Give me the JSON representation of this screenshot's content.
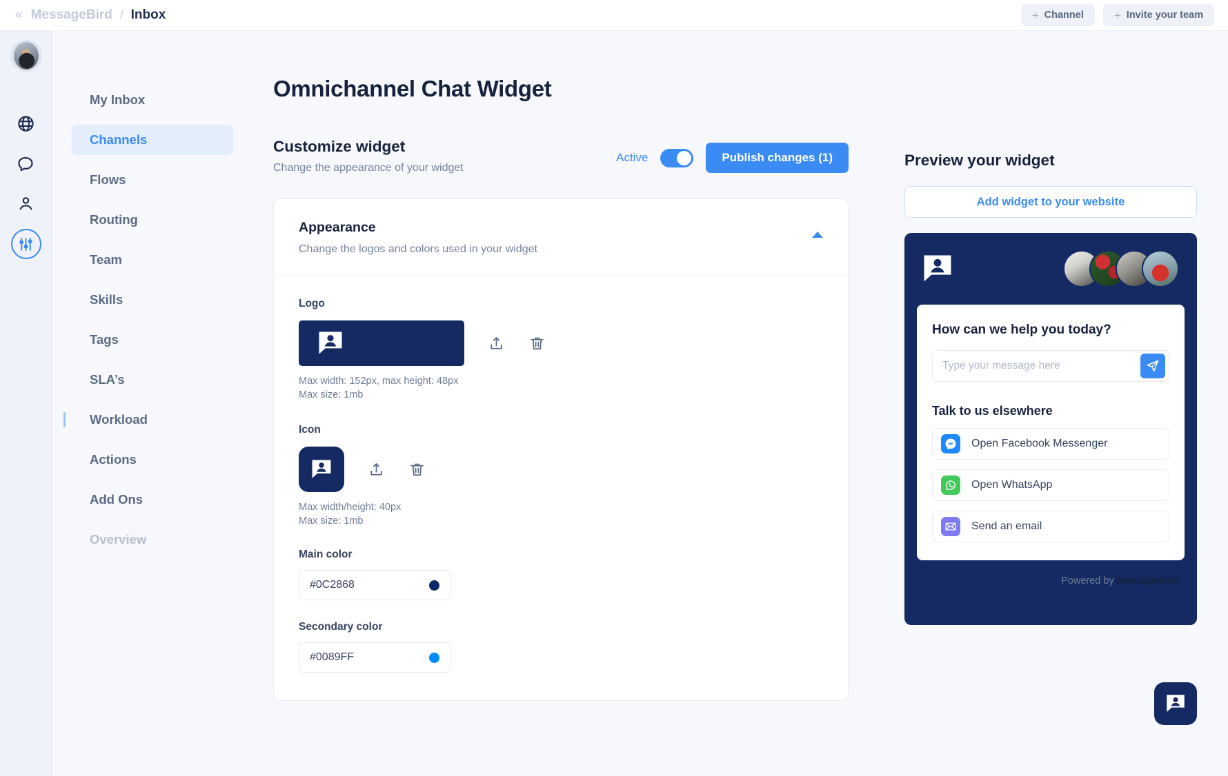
{
  "topbar": {
    "back_icon": "chevron-double-left-icon",
    "brand": "MessageBird",
    "separator": "/",
    "current": "Inbox",
    "channel_button": "Channel",
    "invite_button": "Invite your team",
    "plus": "+"
  },
  "rail": {
    "icons": [
      "avatar",
      "globe-icon",
      "chat-bubble-icon",
      "person-icon",
      "sliders-icon"
    ]
  },
  "sidebar": {
    "items": [
      {
        "label": "My Inbox",
        "state": "default"
      },
      {
        "label": "Channels",
        "state": "selected"
      },
      {
        "label": "Flows",
        "state": "default"
      },
      {
        "label": "Routing",
        "state": "default"
      },
      {
        "label": "Team",
        "state": "default"
      },
      {
        "label": "Skills",
        "state": "default"
      },
      {
        "label": "Tags",
        "state": "default"
      },
      {
        "label": "SLA’s",
        "state": "default"
      },
      {
        "label": "Workload",
        "state": "marked"
      },
      {
        "label": "Actions",
        "state": "default"
      },
      {
        "label": "Add Ons",
        "state": "default"
      },
      {
        "label": "Overview",
        "state": "muted"
      }
    ]
  },
  "main": {
    "page_title": "Omnichannel Chat Widget",
    "section": {
      "title": "Customize widget",
      "subtitle": "Change the appearance of your widget",
      "toggle_label": "Active",
      "toggle_state": "on",
      "publish_button": "Publish changes (1)"
    },
    "appearance_card": {
      "title": "Appearance",
      "subtitle": "Change the logos and colors used in your widget",
      "collapse_icon": "chevron-up-icon",
      "logo": {
        "label": "Logo",
        "hint_line1": "Max width: 152px, max height: 48px",
        "hint_line2": "Max size: 1mb",
        "upload_icon": "upload-icon",
        "delete_icon": "trash-icon"
      },
      "icon": {
        "label": "Icon",
        "hint_line1": "Max width/height: 40px",
        "hint_line2": "Max size: 1mb",
        "upload_icon": "upload-icon",
        "delete_icon": "trash-icon"
      },
      "main_color": {
        "label": "Main color",
        "value": "#0C2868"
      },
      "secondary_color": {
        "label": "Secondary color",
        "value": "#0089FF"
      }
    }
  },
  "preview": {
    "title": "Preview your widget",
    "add_widget_button": "Add widget to your website",
    "widget": {
      "logo_icon": "chat-person-logo-icon",
      "agents_count": 4,
      "card_title": "How can we help you today?",
      "input_placeholder": "Type your message here",
      "input_value": "",
      "send_icon": "send-icon",
      "channels_title": "Talk to us elsewhere",
      "channels": [
        {
          "label": "Open Facebook Messenger",
          "icon": "messenger-icon"
        },
        {
          "label": "Open WhatsApp",
          "icon": "whatsapp-icon"
        },
        {
          "label": "Send an email",
          "icon": "email-icon"
        }
      ],
      "powered_prefix": "Powered by ",
      "powered_brand": "MessageBird"
    },
    "launcher_icon": "chat-person-logo-icon"
  },
  "colors": {
    "main": "#0C2868",
    "secondary": "#0089FF",
    "accent_blue": "#3B8BF5",
    "navy": "#152A63"
  }
}
